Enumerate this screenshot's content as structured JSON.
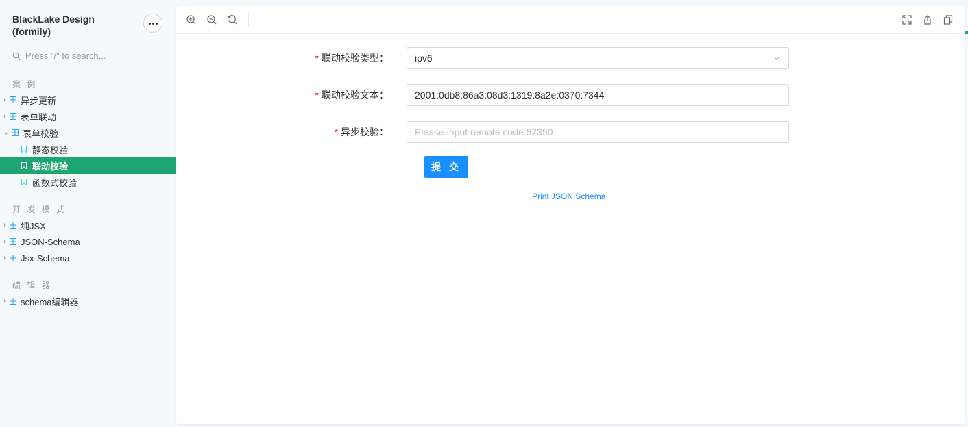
{
  "sidebar": {
    "brand_line1": "BlackLake Design",
    "brand_line2": "(formily)",
    "search_placeholder": "Press \"/\" to search...",
    "sections": [
      {
        "title": "案 例",
        "items": [
          {
            "label": "异步更新"
          },
          {
            "label": "表单联动"
          },
          {
            "label": "表单校验",
            "children": [
              {
                "label": "静态校验"
              },
              {
                "label": "联动校验",
                "active": true
              },
              {
                "label": "函数式校验"
              }
            ]
          }
        ]
      },
      {
        "title": "开 发 模 式",
        "items": [
          {
            "label": "纯JSX"
          },
          {
            "label": "JSON-Schema"
          },
          {
            "label": "Jsx-Schema"
          }
        ]
      },
      {
        "title": "编 辑 器",
        "items": [
          {
            "label": "schema编辑器"
          }
        ]
      }
    ]
  },
  "toolbar": {
    "icons": [
      "zoom-in-icon",
      "zoom-out-icon",
      "reset-zoom-icon",
      "fullscreen-icon",
      "share-icon",
      "copy-icon"
    ]
  },
  "form": {
    "fields": [
      {
        "label": "联动校验类型",
        "required": true,
        "type": "select",
        "value": "ipv6"
      },
      {
        "label": "联动校验文本",
        "required": true,
        "type": "input",
        "value": "2001:0db8:86a3:08d3:1319:8a2e:0370:7344"
      },
      {
        "label": "异步校验",
        "required": true,
        "type": "input",
        "value": "",
        "placeholder": "Please input remote code:57350"
      }
    ],
    "label_colon": "：",
    "required_mark": "*",
    "submit_label": "提 交",
    "print_link": "Print JSON Schema"
  },
  "colors": {
    "accent": "#1ea672",
    "primary": "#1890ff",
    "required": "#f5222d"
  }
}
